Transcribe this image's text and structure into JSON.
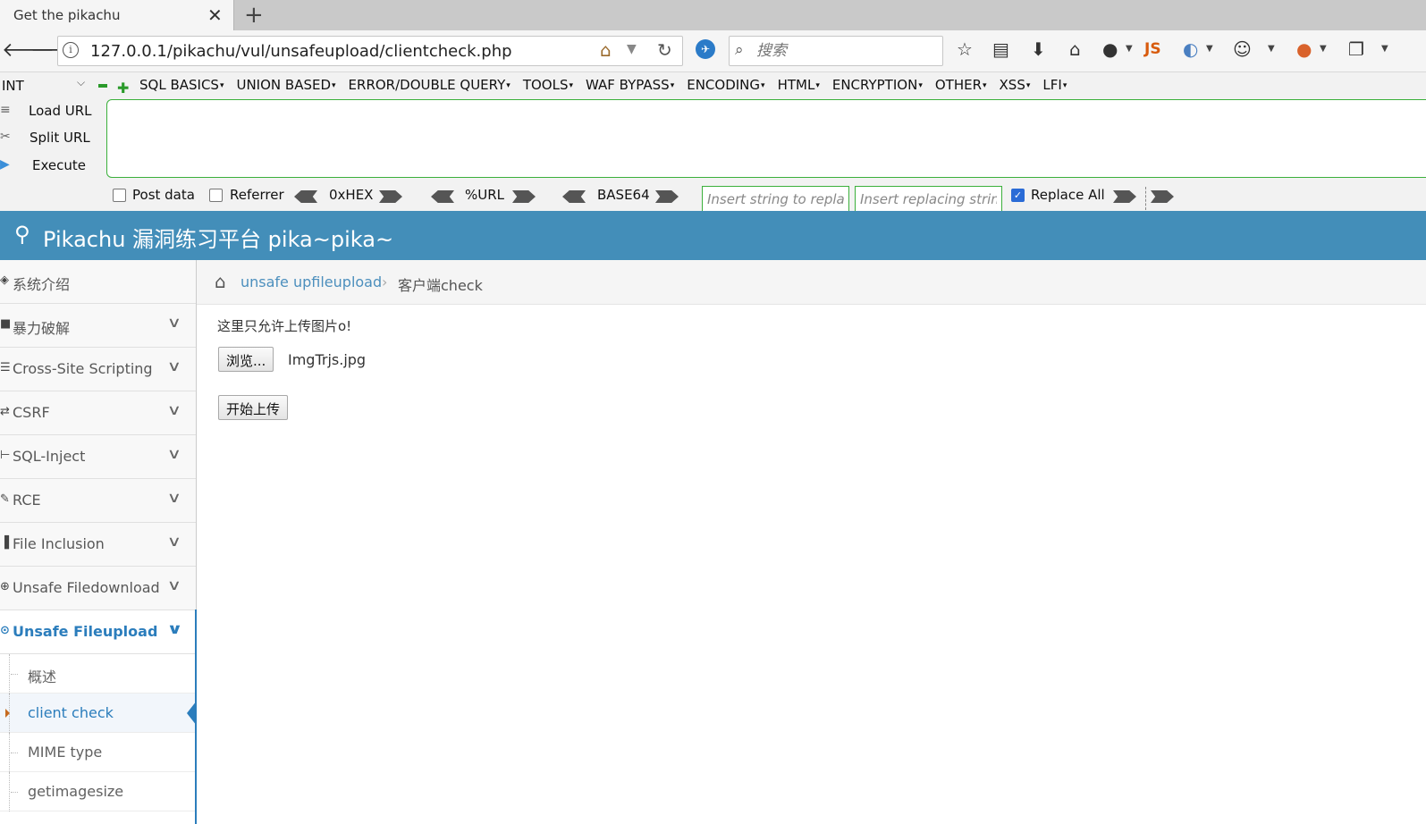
{
  "browser": {
    "tab_title": "Get the pikachu",
    "tab_close": "✕",
    "new_tab": "+",
    "url": "127.0.0.1/pikachu/vul/unsafeupload/clientcheck.php",
    "search_placeholder": "搜索",
    "toolbar_js_label": "JS",
    "icons": [
      "back-icon",
      "forward-icon",
      "info-icon",
      "home-icon",
      "reload-icon",
      "search-icon",
      "bookmark-star-icon",
      "reading-list-icon",
      "download-icon",
      "home-icon",
      "globe-icon",
      "js-icon",
      "extension-icon",
      "palette-icon",
      "fox-icon",
      "overflow-icon"
    ]
  },
  "hackbar": {
    "select_value": "INT",
    "menu": [
      "SQL BASICS",
      "UNION BASED",
      "ERROR/DOUBLE QUERY",
      "TOOLS",
      "WAF BYPASS",
      "ENCODING",
      "HTML",
      "ENCRYPTION",
      "OTHER",
      "XSS",
      "LFI"
    ],
    "side": {
      "load": "Load URL",
      "split": "Split URL",
      "execute": "Execute"
    },
    "options": {
      "post_data": "Post data",
      "referrer": "Referrer",
      "hex": "0xHEX",
      "url": "%URL",
      "base64": "BASE64",
      "replace_from_placeholder": "Insert string to replace",
      "replace_to_placeholder": "Insert replacing string",
      "replace_all": "Replace All",
      "replace_all_checked": true
    },
    "accent_color": "#3bb03b"
  },
  "page": {
    "header_title": "Pikachu 漏洞练习平台 pika~pika~",
    "header_color": "#438eb9"
  },
  "sidebar": {
    "items": [
      {
        "label": "系统介绍",
        "icon": "desktop-icon"
      },
      {
        "label": "暴力破解",
        "icon": "lock-icon"
      },
      {
        "label": "Cross-Site Scripting",
        "icon": "list-icon"
      },
      {
        "label": "CSRF",
        "icon": "exchange-icon"
      },
      {
        "label": "SQL-Inject",
        "icon": "syringe-icon"
      },
      {
        "label": "RCE",
        "icon": "pencil-icon"
      },
      {
        "label": "File Inclusion",
        "icon": "file-icon"
      },
      {
        "label": "Unsafe Filedownload",
        "icon": "download-circle-icon"
      },
      {
        "label": "Unsafe Fileupload",
        "icon": "upload-circle-icon",
        "active": true
      }
    ],
    "sub_items": [
      {
        "label": "概述"
      },
      {
        "label": "client check",
        "active": true
      },
      {
        "label": "MIME type"
      },
      {
        "label": "getimagesize"
      }
    ]
  },
  "breadcrumb": {
    "link": "unsafe upfileupload",
    "separator": "›",
    "current": "客户端check"
  },
  "main": {
    "notice": "这里只允许上传图片o!",
    "browse_button": "浏览...",
    "file_name": "ImgTrjs.jpg",
    "upload_button": "开始上传"
  }
}
